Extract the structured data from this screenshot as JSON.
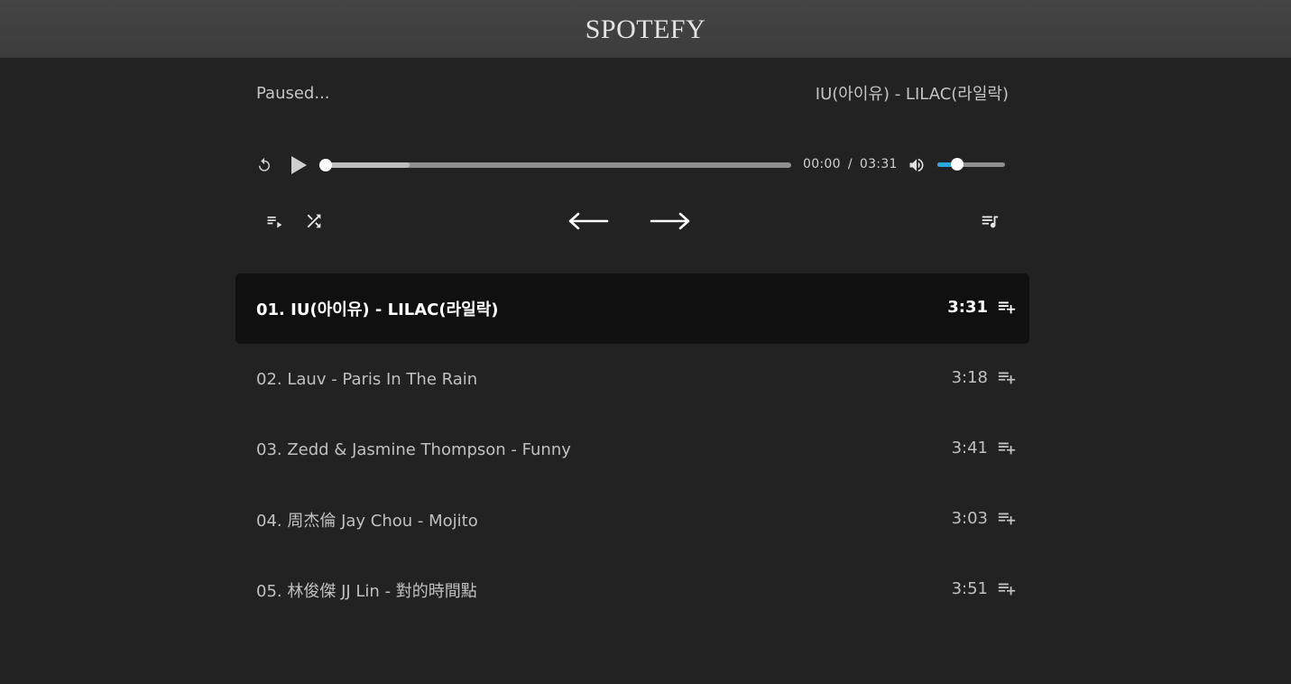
{
  "header": {
    "title": "SPOTEFY"
  },
  "player": {
    "status": "Paused...",
    "now_playing": "IU(아이유) - LILAC(라일락)",
    "current_time": "00:00",
    "time_separator": "/",
    "total_time": "03:31",
    "progress_fraction": 0,
    "buffered_fraction": 0.18,
    "volume_fraction": 0.29,
    "accent_color": "#29a8e0"
  },
  "icons": {
    "replay": "replay-icon",
    "play": "play-icon",
    "volume": "volume-icon",
    "playlist_play": "playlist-play-icon",
    "shuffle": "shuffle-icon",
    "previous": "arrow-left-icon",
    "next": "arrow-right-icon",
    "queue_music": "queue-music-icon",
    "playlist_add": "playlist-add-icon"
  },
  "tracks": [
    {
      "title": "01. IU(아이유) - LILAC(라일락)",
      "duration": "3:31",
      "active": true
    },
    {
      "title": "02. Lauv - Paris In The Rain",
      "duration": "3:18",
      "active": false
    },
    {
      "title": "03. Zedd & Jasmine Thompson - Funny",
      "duration": "3:41",
      "active": false
    },
    {
      "title": "04. 周杰倫 Jay Chou - Mojito",
      "duration": "3:03",
      "active": false
    },
    {
      "title": "05. 林俊傑 JJ Lin - 對的時間點",
      "duration": "3:51",
      "active": false
    }
  ]
}
